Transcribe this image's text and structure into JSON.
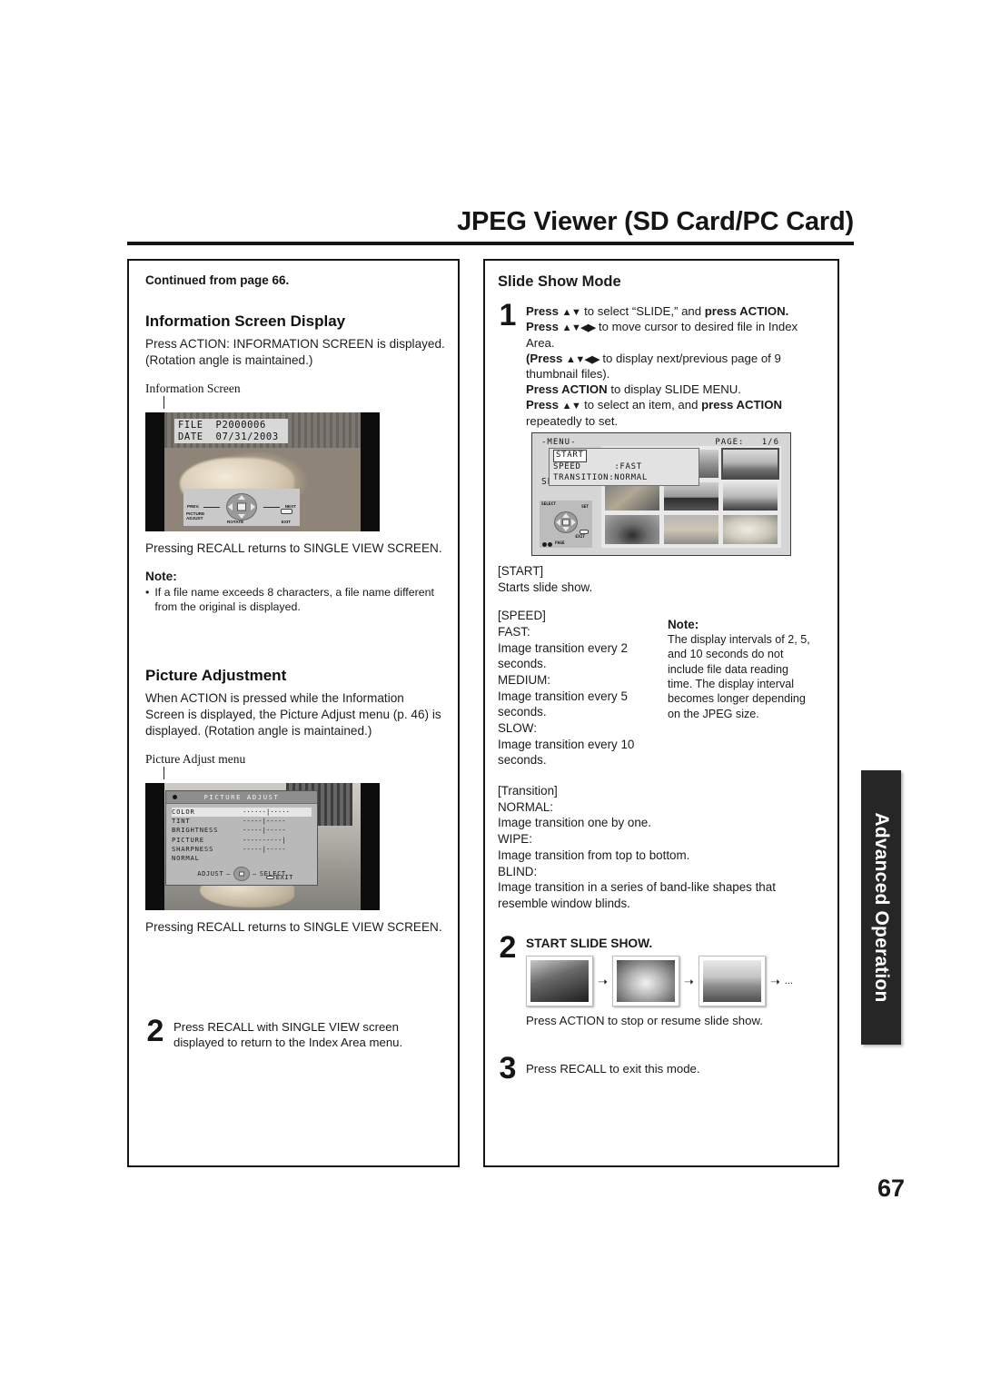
{
  "header": {
    "title": "JPEG Viewer (SD Card/PC Card)"
  },
  "page_number": "67",
  "side_tab": {
    "label": "Advanced Operation"
  },
  "left_column": {
    "continued": "Continued from page 66.",
    "section_title": "Information Screen Display",
    "intro": "Press ACTION: INFORMATION SCREEN is displayed. (Rotation angle is maintained.)",
    "figure_caption": "Information Screen",
    "info_screen": {
      "file_label": "FILE",
      "file_value": "P2000006",
      "date_label": "DATE",
      "date_value": "07/31/2003",
      "navpad": {
        "prev": "PREV.",
        "next": "NEXT",
        "picture_adjust": "PICTURE\nADJUST",
        "rotate": "ROTATE",
        "exit": "EXIT"
      }
    },
    "after_figure": "Pressing RECALL returns to SINGLE VIEW SCREEN.",
    "note_head": "Note:",
    "note_bullet": "If a file name exceeds 8 characters, a file name different from the original is displayed.",
    "section2_title": "Picture Adjustment",
    "section2_body": "When ACTION is pressed while the Information Screen is displayed, the Picture Adjust menu (p. 46) is displayed. (Rotation angle is maintained.)",
    "figure2_caption": "Picture Adjust menu",
    "picture_adjust_menu": {
      "title": "PICTURE ADJUST",
      "rows": [
        {
          "name": "COLOR",
          "bar": "······|·····",
          "selected": true
        },
        {
          "name": "TINT",
          "bar": "-----|-----",
          "selected": false
        },
        {
          "name": "BRIGHTNESS",
          "bar": "-----|-----",
          "selected": false
        },
        {
          "name": "PICTURE",
          "bar": "----------|",
          "selected": false
        },
        {
          "name": "SHARPNESS",
          "bar": "-----|-----",
          "selected": false
        },
        {
          "name": "NORMAL",
          "bar": "",
          "selected": false
        }
      ],
      "foot_left": "ADJUST",
      "foot_right": "SELECT",
      "foot_exit": "EXIT"
    },
    "after_figure2": "Pressing RECALL returns to SINGLE VIEW SCREEN.",
    "step2": {
      "num": "2",
      "text_a": "Press RECALL with SINGLE VIEW",
      "text_b": " screen displayed to return to the Index Area menu."
    }
  },
  "right_column": {
    "section_title": "Slide Show Mode",
    "step1": {
      "num": "1",
      "l1_a": "Press",
      "l1_arrows": "▲▼",
      "l1_b": "to select “SLIDE,” and",
      "l1_c": "press ACTION.",
      "l2_a": "Press",
      "l2_arrows": "▲▼◀▶",
      "l2_b": "to move cursor to desired file in Index Area.",
      "l3_a": "(Press",
      "l3_arrows": "▲▼◀▶",
      "l3_b": "to display next/previous page of 9 thumbnail files).",
      "l4_a": "Press ACTION",
      "l4_b": "to display SLIDE MENU.",
      "l5_a": "Press",
      "l5_arrows": "▲▼",
      "l5_b": "to select an item, and",
      "l5_c": "press ACTION",
      "l5_d": "repeatedly to set."
    },
    "slide_osd": {
      "menu_label": "-MENU-",
      "page_label": "PAGE:",
      "page_value": "1/6",
      "item_start": "START",
      "item_speed_name": "SPEED",
      "item_speed_value": ":FAST",
      "item_transition_name": "TRANSITION",
      "item_transition_value": ":NORMAL",
      "source": "SD/PC",
      "nav": {
        "select": "SELECT",
        "set": "SET",
        "exit": "EXIT",
        "page": "PAGE"
      }
    },
    "defs": [
      {
        "key": "[START]",
        "val": "Starts slide show."
      },
      {
        "key": "[SPEED]",
        "val": ""
      },
      {
        "key": "FAST:",
        "val": "Image transition every 2 seconds."
      },
      {
        "key": "MEDIUM:",
        "val": "Image transition every 5 seconds."
      },
      {
        "key": "SLOW:",
        "val": "Image transition every 10 seconds."
      }
    ],
    "defs2": [
      {
        "key": "[Transition]",
        "val": ""
      },
      {
        "key": "NORMAL:",
        "val": "Image transition one by one."
      },
      {
        "key": "WIPE:",
        "val": "Image transition from top to bottom."
      },
      {
        "key": "BLIND:",
        "val": "Image transition in a series of band-like shapes that resemble window blinds."
      }
    ],
    "note": {
      "head": "Note:",
      "body": "The display intervals of 2, 5, and 10 seconds do not include file data reading time. The display interval becomes longer depending on the JPEG size."
    },
    "step2": {
      "num": "2",
      "title": "START SLIDE SHOW.",
      "arrow": "➝",
      "ellipsis": "...",
      "caption": "Press ACTION to stop or resume slide show."
    },
    "step3": {
      "num": "3",
      "text": "Press RECALL to exit this mode."
    }
  }
}
